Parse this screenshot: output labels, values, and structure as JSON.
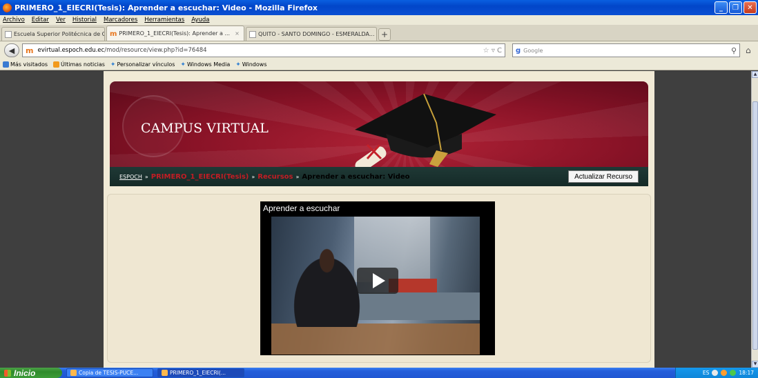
{
  "window": {
    "title": "PRIMERO_1_EIECRI(Tesis): Aprender a escuchar: Video - Mozilla Firefox",
    "controls": [
      "_",
      "❐",
      "✕"
    ]
  },
  "menu": [
    "Archivo",
    "Editar",
    "Ver",
    "Historial",
    "Marcadores",
    "Herramientas",
    "Ayuda"
  ],
  "tabs": [
    {
      "label": "Escuela Superior Politécnica de Chimborazo",
      "active": false
    },
    {
      "label": "PRIMERO_1_EIECRI(Tesis): Aprender a ...",
      "active": true
    },
    {
      "label": "QUITO - SANTO DOMINGO - ESMERALDA...",
      "active": false
    }
  ],
  "newtab_label": "+",
  "address": {
    "domain": "evirtual.espoch.edu.ec",
    "path": "/mod/resource/view.php?id=76484",
    "right_icons": "☆ ▿ C"
  },
  "search": {
    "placeholder": "Google",
    "engine": "g"
  },
  "bookmarks": [
    "Más visitados",
    "Últimas noticias",
    "Personalizar vínculos",
    "Windows Media",
    "Windows"
  ],
  "site": {
    "header_title": "CAMPUS VIRTUAL",
    "breadcrumb": {
      "root": "ESPOCH",
      "sep": "»",
      "course": "PRIMERO_1_EIECRI(Tesis)",
      "section": "Recursos",
      "current": "Aprender a escuchar: Video"
    },
    "update_button": "Actualizar Recurso",
    "video_title": "Aprender a escuchar"
  },
  "taskbar": {
    "start_label": "Inicio",
    "tasks": [
      {
        "label": "Copia de TESIS-PUCE...",
        "active": false
      },
      {
        "label": "PRIMERO_1_EIECRI(...",
        "active": true
      }
    ],
    "lang": "ES",
    "clock": "18:17"
  },
  "colors": {
    "banner_red": "#8a1327",
    "page_bg": "#f1ead6",
    "breadcrumb_link": "#c21d24",
    "titlebar_blue": "#0246c9"
  }
}
